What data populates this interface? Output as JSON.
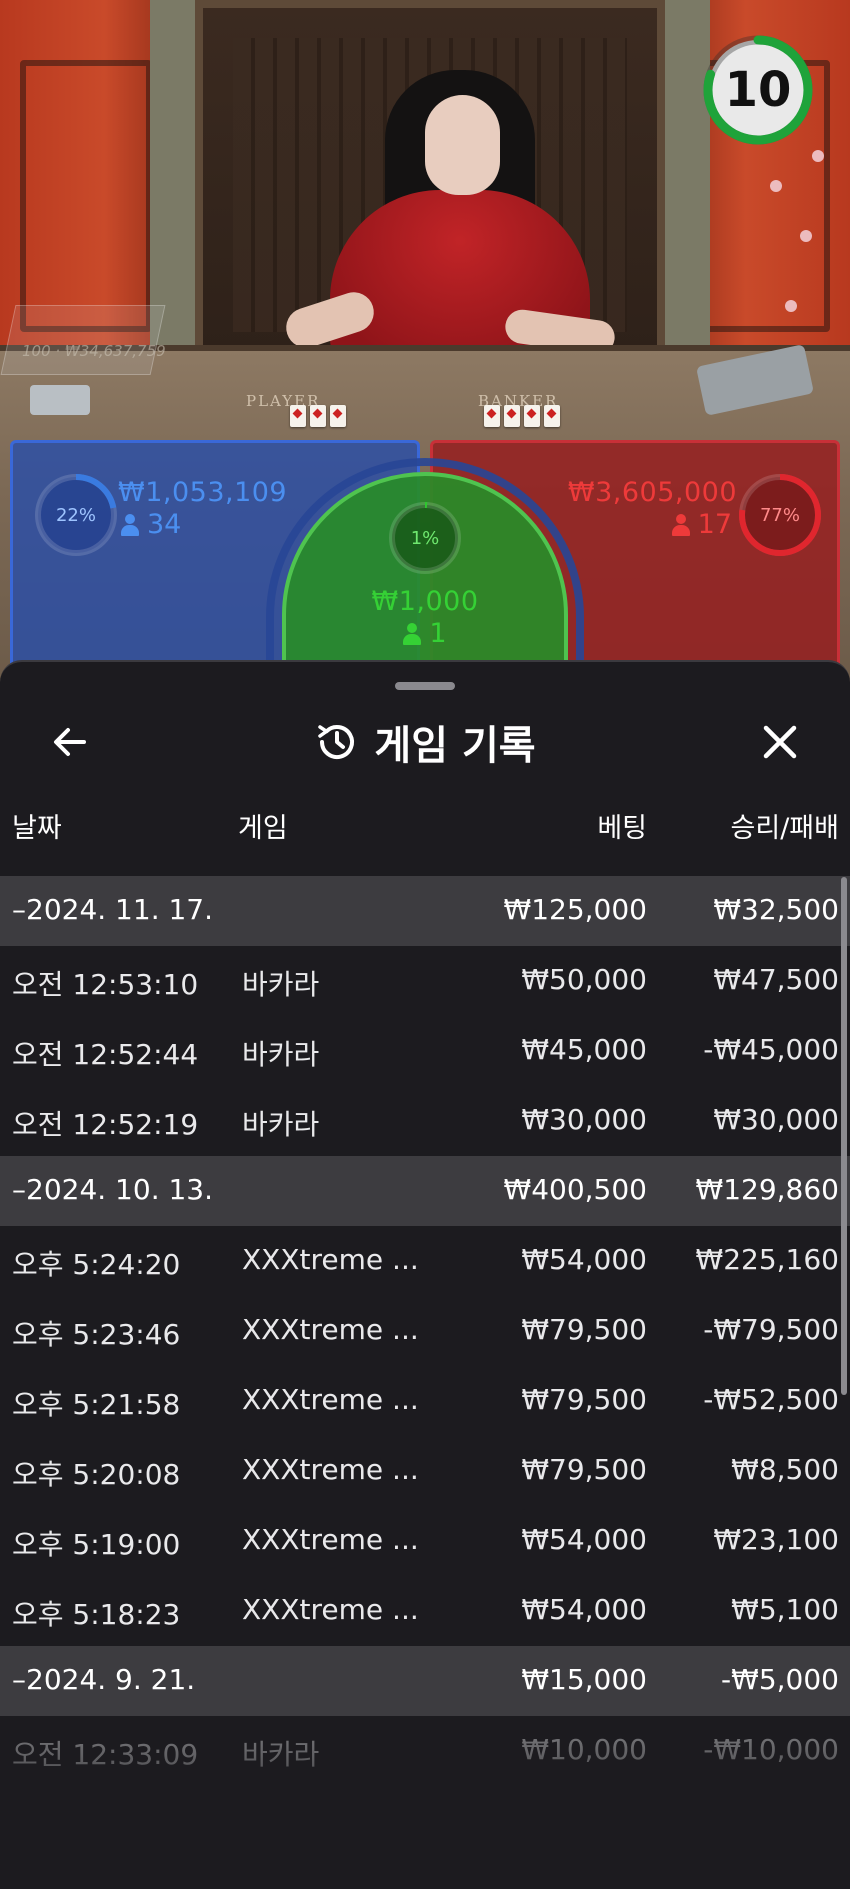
{
  "timer": {
    "seconds": "10",
    "fraction_remaining": 0.8,
    "color": "#1fa33a"
  },
  "table": {
    "player_label": "PLAYER",
    "banker_label": "BANKER",
    "ticker": "100 · ₩34,637,759"
  },
  "bets": {
    "player": {
      "percent": "22%",
      "percent_value": 0.22,
      "amount": "₩1,053,109",
      "players": "34",
      "color": "#3a7be0"
    },
    "tie": {
      "percent": "1%",
      "percent_value": 0.01,
      "amount": "₩1,000",
      "players": "1",
      "color": "#2ec82e"
    },
    "banker": {
      "percent": "77%",
      "percent_value": 0.77,
      "amount": "₩3,605,000",
      "players": "17",
      "color": "#e0262e"
    }
  },
  "history": {
    "title": "게임 기록",
    "back_icon": "arrow-left-icon",
    "history_icon": "history-clock-icon",
    "close_icon": "close-icon",
    "columns": {
      "date": "날짜",
      "game": "게임",
      "bet": "베팅",
      "result": "승리/패배"
    },
    "groups": [
      {
        "date": "–2024. 11. 17.",
        "bet": "₩125,000",
        "result": "₩32,500",
        "rows": [
          {
            "time": "오전 12:53:10",
            "game": "바카라",
            "bet": "₩50,000",
            "result": "₩47,500"
          },
          {
            "time": "오전 12:52:44",
            "game": "바카라",
            "bet": "₩45,000",
            "result": "-₩45,000"
          },
          {
            "time": "오전 12:52:19",
            "game": "바카라",
            "bet": "₩30,000",
            "result": "₩30,000"
          }
        ]
      },
      {
        "date": "–2024. 10. 13.",
        "bet": "₩400,500",
        "result": "₩129,860",
        "rows": [
          {
            "time": "오후 5:24:20",
            "game": "XXXtreme ...",
            "bet": "₩54,000",
            "result": "₩225,160"
          },
          {
            "time": "오후 5:23:46",
            "game": "XXXtreme ...",
            "bet": "₩79,500",
            "result": "-₩79,500"
          },
          {
            "time": "오후 5:21:58",
            "game": "XXXtreme ...",
            "bet": "₩79,500",
            "result": "-₩52,500"
          },
          {
            "time": "오후 5:20:08",
            "game": "XXXtreme ...",
            "bet": "₩79,500",
            "result": "₩8,500"
          },
          {
            "time": "오후 5:19:00",
            "game": "XXXtreme ...",
            "bet": "₩54,000",
            "result": "₩23,100"
          },
          {
            "time": "오후 5:18:23",
            "game": "XXXtreme ...",
            "bet": "₩54,000",
            "result": "₩5,100"
          }
        ]
      },
      {
        "date": "–2024. 9. 21.",
        "bet": "₩15,000",
        "result": "-₩5,000",
        "rows": [
          {
            "time": "오전 12:33:09",
            "game": "바카라",
            "bet": "₩10,000",
            "result": "-₩10,000"
          }
        ]
      }
    ]
  }
}
